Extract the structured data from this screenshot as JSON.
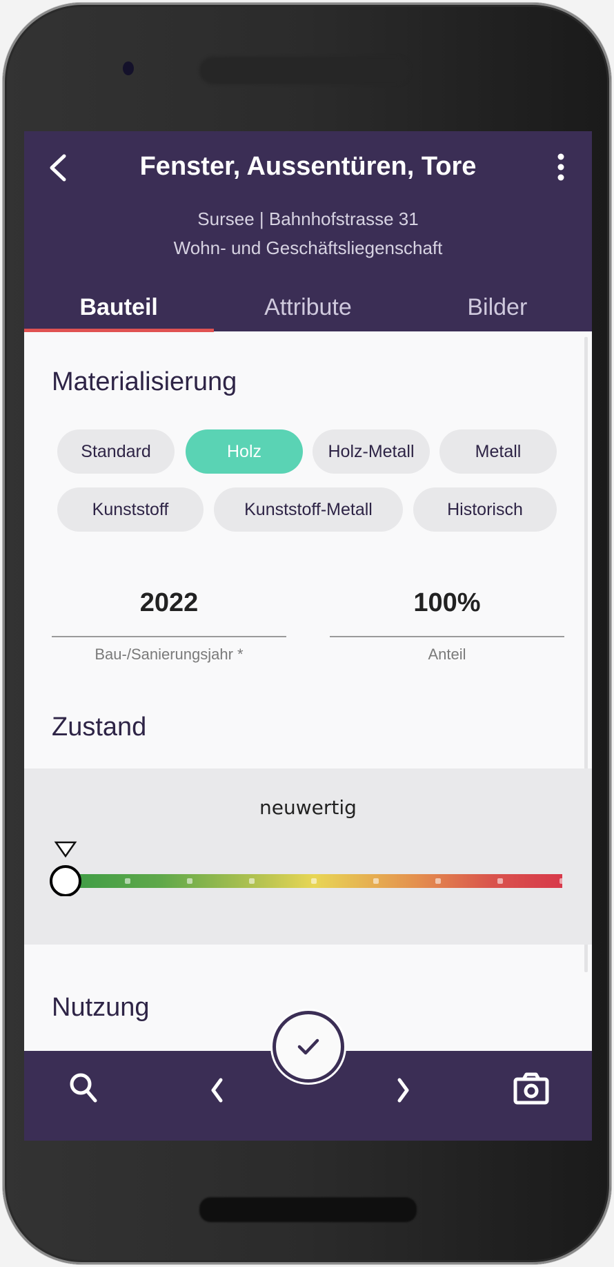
{
  "header": {
    "title": "Fenster, Aussentüren, Tore",
    "location": "Sursee | Bahnhofstrasse 31",
    "property_type": "Wohn- und Geschäftsliegenschaft",
    "back_icon": "chevron-left-icon",
    "more_icon": "more-vertical-icon"
  },
  "tabs": [
    {
      "label": "Bauteil",
      "active": true
    },
    {
      "label": "Attribute",
      "active": false
    },
    {
      "label": "Bilder",
      "active": false
    }
  ],
  "materialisierung": {
    "title": "Materialisierung",
    "options": [
      {
        "label": "Standard",
        "selected": false
      },
      {
        "label": "Holz",
        "selected": true
      },
      {
        "label": "Holz-Metall",
        "selected": false
      },
      {
        "label": "Metall",
        "selected": false
      },
      {
        "label": "Kunststoff",
        "selected": false
      },
      {
        "label": "Kunststoff-Metall",
        "selected": false
      },
      {
        "label": "Historisch",
        "selected": false
      }
    ]
  },
  "fields": {
    "year": {
      "value": "2022",
      "label": "Bau-/Sanierungsjahr *"
    },
    "share": {
      "value": "100%",
      "label": "Anteil"
    }
  },
  "zustand": {
    "title": "Zustand",
    "value_label": "neuwertig",
    "slider": {
      "steps": 9,
      "current_step": 0
    }
  },
  "nutzung": {
    "title": "Nutzung"
  },
  "bottom_bar": {
    "search_icon": "search-icon",
    "prev_icon": "chevron-left-icon",
    "confirm_icon": "check-icon",
    "next_icon": "chevron-right-icon",
    "camera_icon": "camera-icon"
  },
  "colors": {
    "primary": "#3b2e55",
    "accent_tab": "#e05252",
    "chip_selected": "#5ad3b4",
    "gradient": [
      "#3a9b45",
      "#e8d655",
      "#d8364a"
    ]
  }
}
